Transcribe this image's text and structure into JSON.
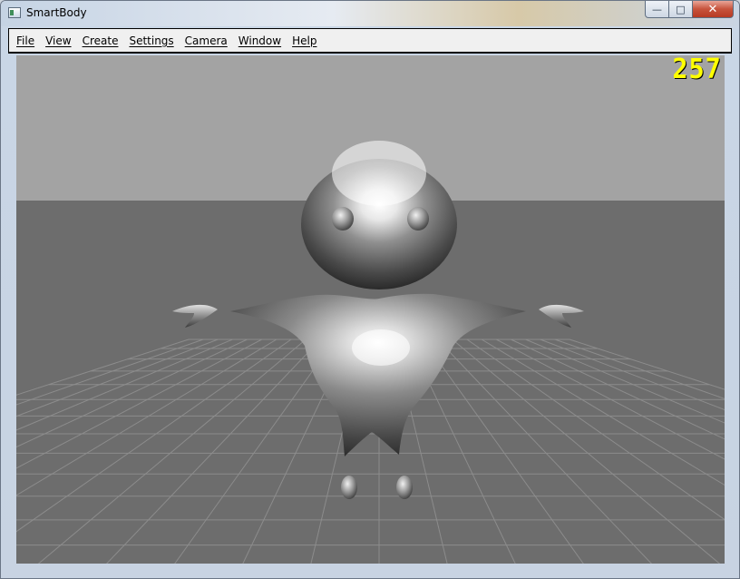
{
  "window": {
    "title": "SmartBody",
    "buttons": {
      "minimize": "—",
      "maximize": "□",
      "close": "✕"
    }
  },
  "menu": {
    "items": [
      "File",
      "View",
      "Create",
      "Settings",
      "Camera",
      "Window",
      "Help"
    ]
  },
  "viewport": {
    "frame_counter": "257",
    "colors": {
      "sky": "#a3a3a3",
      "ground": "#6d6d6d",
      "grid": "#8c8c8c",
      "counter": "#ffff00",
      "character": "#8a8a8a"
    }
  }
}
